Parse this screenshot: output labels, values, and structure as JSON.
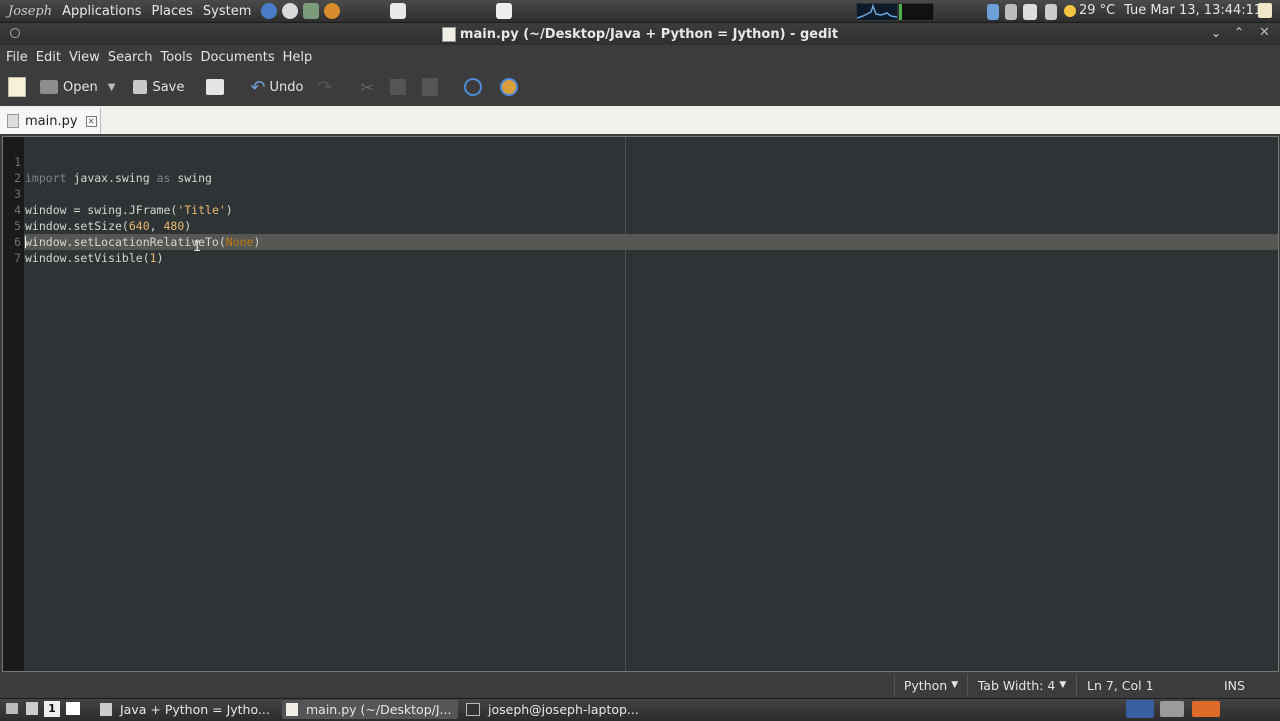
{
  "top_panel": {
    "user": "Joseph",
    "menus": [
      "Applications",
      "Places",
      "System"
    ],
    "weather": "29 °C",
    "clock": "Tue Mar 13, 13:44:11"
  },
  "window": {
    "title": "main.py (~/Desktop/Java + Python = Jython) - gedit"
  },
  "menubar": [
    "File",
    "Edit",
    "View",
    "Search",
    "Tools",
    "Documents",
    "Help"
  ],
  "toolbar": {
    "open_label": "Open",
    "save_label": "Save",
    "undo_label": "Undo"
  },
  "tab": {
    "label": "main.py"
  },
  "editor": {
    "lines": [
      {
        "n": "1",
        "text": "import javax.swing as swing"
      },
      {
        "n": "2",
        "text": ""
      },
      {
        "n": "3",
        "text": "window = swing.JFrame('Title')"
      },
      {
        "n": "4",
        "text": "window.setSize(640, 480)"
      },
      {
        "n": "5",
        "text": "window.setLocationRelativeTo(None)"
      },
      {
        "n": "6",
        "text": "window.setVisible(1)"
      },
      {
        "n": "7",
        "text": ""
      }
    ]
  },
  "statusbar": {
    "language": "Python",
    "tab_width": "Tab Width:  4",
    "position": "Ln 7, Col 1",
    "mode": "INS"
  },
  "taskbar": {
    "tasks": [
      "Java + Python = Jytho...",
      "main.py (~/Desktop/J...",
      "joseph@joseph-laptop..."
    ],
    "workspace": "1"
  }
}
